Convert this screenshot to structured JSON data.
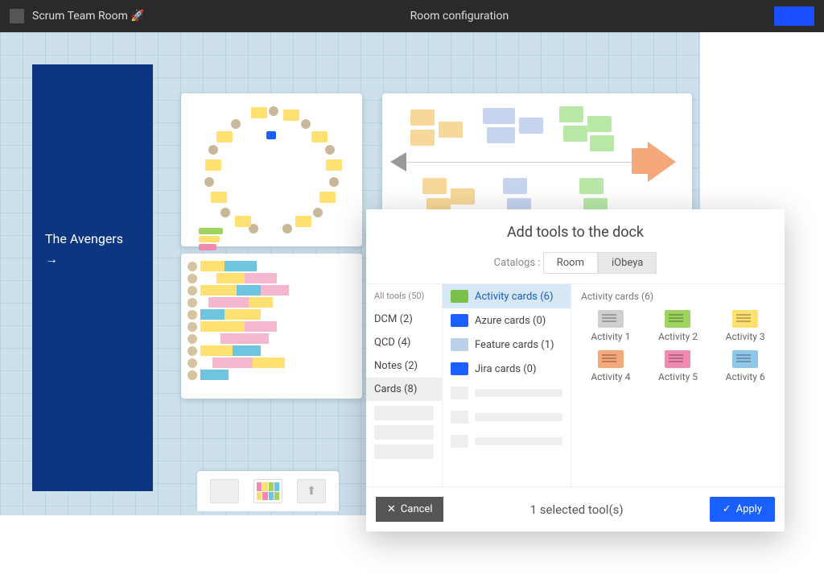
{
  "topbar": {
    "room_name": "Scrum Team Room 🚀",
    "page_title": "Room configuration"
  },
  "side_panel": {
    "team_name": "The Avengers",
    "arrow": "→"
  },
  "modal": {
    "title": "Add tools to the dock",
    "catalogs_label": "Catalogs :",
    "tabs": {
      "room": "Room",
      "iobeya": "iObeya"
    },
    "categories": {
      "header": "All tools (50)",
      "items": [
        "DCM (2)",
        "QCD (4)",
        "Notes (2)",
        "Cards (8)"
      ]
    },
    "tools": [
      {
        "label": "Activity cards (6)",
        "color": "#7cc04a",
        "selected": true
      },
      {
        "label": "Azure cards (0)",
        "color": "#1a5fff",
        "selected": false
      },
      {
        "label": "Feature cards (1)",
        "color": "#b8d0e8",
        "selected": false
      },
      {
        "label": "Jira cards (0)",
        "color": "#1a5fff",
        "selected": false
      }
    ],
    "preview": {
      "header": "Activity cards (6)",
      "items": [
        {
          "label": "Activity 1",
          "color": "#d0d0d0"
        },
        {
          "label": "Activity 2",
          "color": "#9ed35f"
        },
        {
          "label": "Activity 3",
          "color": "#ffe070"
        },
        {
          "label": "Activity 4",
          "color": "#f5a97a"
        },
        {
          "label": "Activity 5",
          "color": "#f08ab0"
        },
        {
          "label": "Activity 6",
          "color": "#8fc7e8"
        }
      ]
    },
    "footer": {
      "cancel": "Cancel",
      "selected": "1 selected tool(s)",
      "apply": "Apply"
    }
  }
}
